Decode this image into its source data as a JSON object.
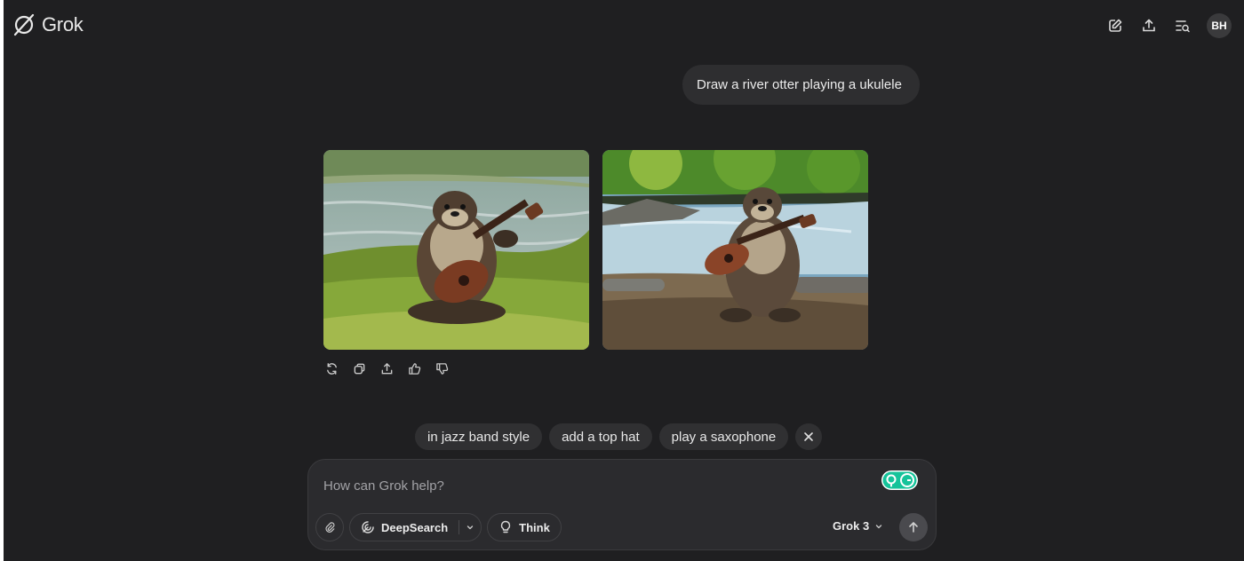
{
  "app": {
    "name": "Grok",
    "user_initials": "BH"
  },
  "header": {
    "icons": [
      "edit-icon",
      "share-icon",
      "history-search-icon"
    ]
  },
  "conversation": {
    "user_message": "Draw a river otter playing a ukulele",
    "images": [
      {
        "name": "otter-ukulele-grass"
      },
      {
        "name": "otter-ukulele-riverbank"
      }
    ],
    "message_actions": [
      "regenerate-icon",
      "copy-icon",
      "share-icon",
      "thumbs-up-icon",
      "thumbs-down-icon"
    ]
  },
  "suggestions": [
    "in jazz band style",
    "add a top hat",
    "play a saxophone"
  ],
  "composer": {
    "placeholder": "How can Grok help?",
    "deepsearch_label": "DeepSearch",
    "think_label": "Think",
    "model_label": "Grok 3"
  },
  "colors": {
    "background": "#1f1f21",
    "bubble": "#2e2e30",
    "chip": "#303032",
    "grammarly": "#15c39a"
  }
}
